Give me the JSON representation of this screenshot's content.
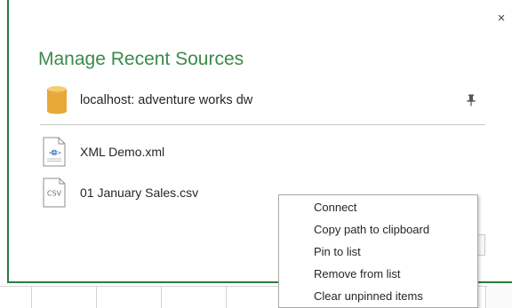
{
  "dialog": {
    "title": "Manage Recent Sources",
    "close_label": "×",
    "accent_color": "#2c7a3f",
    "title_color": "#3a8a4a"
  },
  "sources": [
    {
      "label": "localhost: adventure works dw",
      "icon": "database-icon",
      "pinned": true
    },
    {
      "label": "XML Demo.xml",
      "icon": "xml-file-icon",
      "pinned": false
    },
    {
      "label": "01 January Sales.csv",
      "icon": "csv-file-icon",
      "icon_text": "CSV",
      "pinned": false
    }
  ],
  "context_menu": {
    "items": [
      "Connect",
      "Copy path to clipboard",
      "Pin to list",
      "Remove from list",
      "Clear unpinned items"
    ]
  }
}
